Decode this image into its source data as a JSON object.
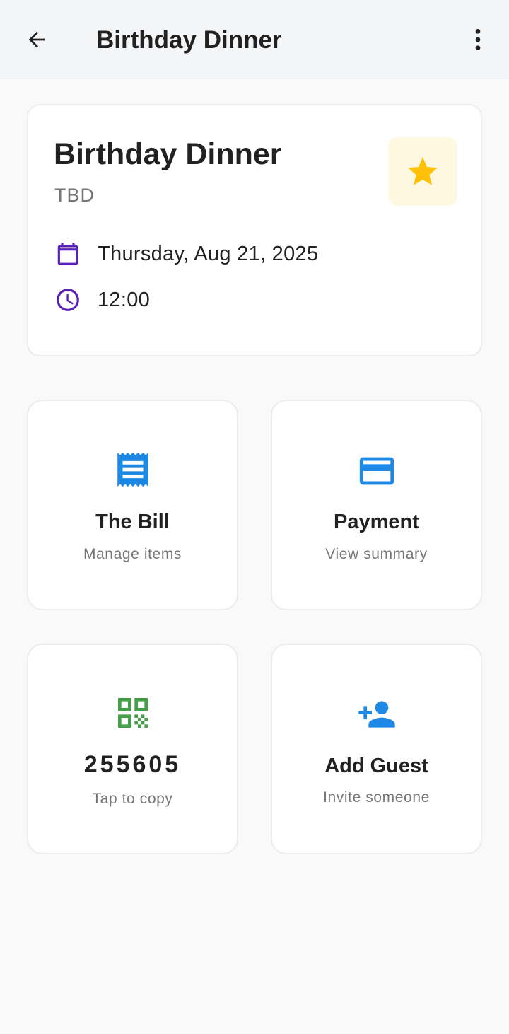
{
  "appbar": {
    "title": "Birthday Dinner",
    "back_icon": "arrow-back-icon",
    "menu_icon": "more-vert-icon"
  },
  "event": {
    "title": "Birthday Dinner",
    "location": "TBD",
    "date": "Thursday, Aug 21, 2025",
    "time": "12:00",
    "favorite_icon": "star-icon"
  },
  "tiles": {
    "bill": {
      "title": "The Bill",
      "subtitle": "Manage items",
      "icon": "receipt-icon"
    },
    "payment": {
      "title": "Payment",
      "subtitle": "View summary",
      "icon": "credit-card-icon"
    },
    "code": {
      "code": "255605",
      "subtitle": "Tap to copy",
      "icon": "qr-code-icon"
    },
    "guest": {
      "title": "Add Guest",
      "subtitle": "Invite someone",
      "icon": "person-add-icon"
    }
  },
  "colors": {
    "accent_purple": "#5b21b6",
    "star": "#ffc107",
    "blue": "#1e88e5",
    "green": "#43a047"
  }
}
